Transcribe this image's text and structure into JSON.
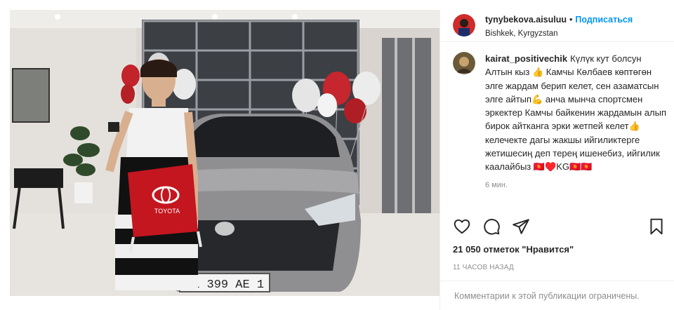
{
  "post": {
    "username": "tynybekova.aisuluu",
    "follow_label": "Подписаться",
    "location": "Bishkek, Kyrgyzstan",
    "photo": {
      "pillow_text": "TOYOTA",
      "plate_text": "01 399 AE 1"
    }
  },
  "comment": {
    "username": "kairat_positivechik",
    "text": "Күлүк кут болсун Алтын кыз 👍 Камчы Көлбаев көптөгөн элге жардам берип келет, сен азаматсын элге айтып💪 анча мынча спортсмен эркектер Камчы байкенин жардамын алып бирок айтканга эрки жетпей келет👍 келечекте дагы жакшы ийгиликтерге жетишесиң деп терең ишенебиз, ийгилик каалайбыз 🇰🇬♥️KG🇰🇬🇰🇬",
    "time": "6 мин."
  },
  "actions": {
    "like": "heart-icon",
    "comment": "comment-icon",
    "share": "share-icon",
    "save": "bookmark-icon"
  },
  "likes_label": "21 050 отметок \"Нравится\"",
  "posted_ago": "11 ЧАСОВ НАЗАД",
  "comments_closed": "Комментарии к этой публикации ограничены.",
  "colors": {
    "accent": "#0095f6",
    "text": "#262626",
    "muted": "#8e8e8e"
  }
}
